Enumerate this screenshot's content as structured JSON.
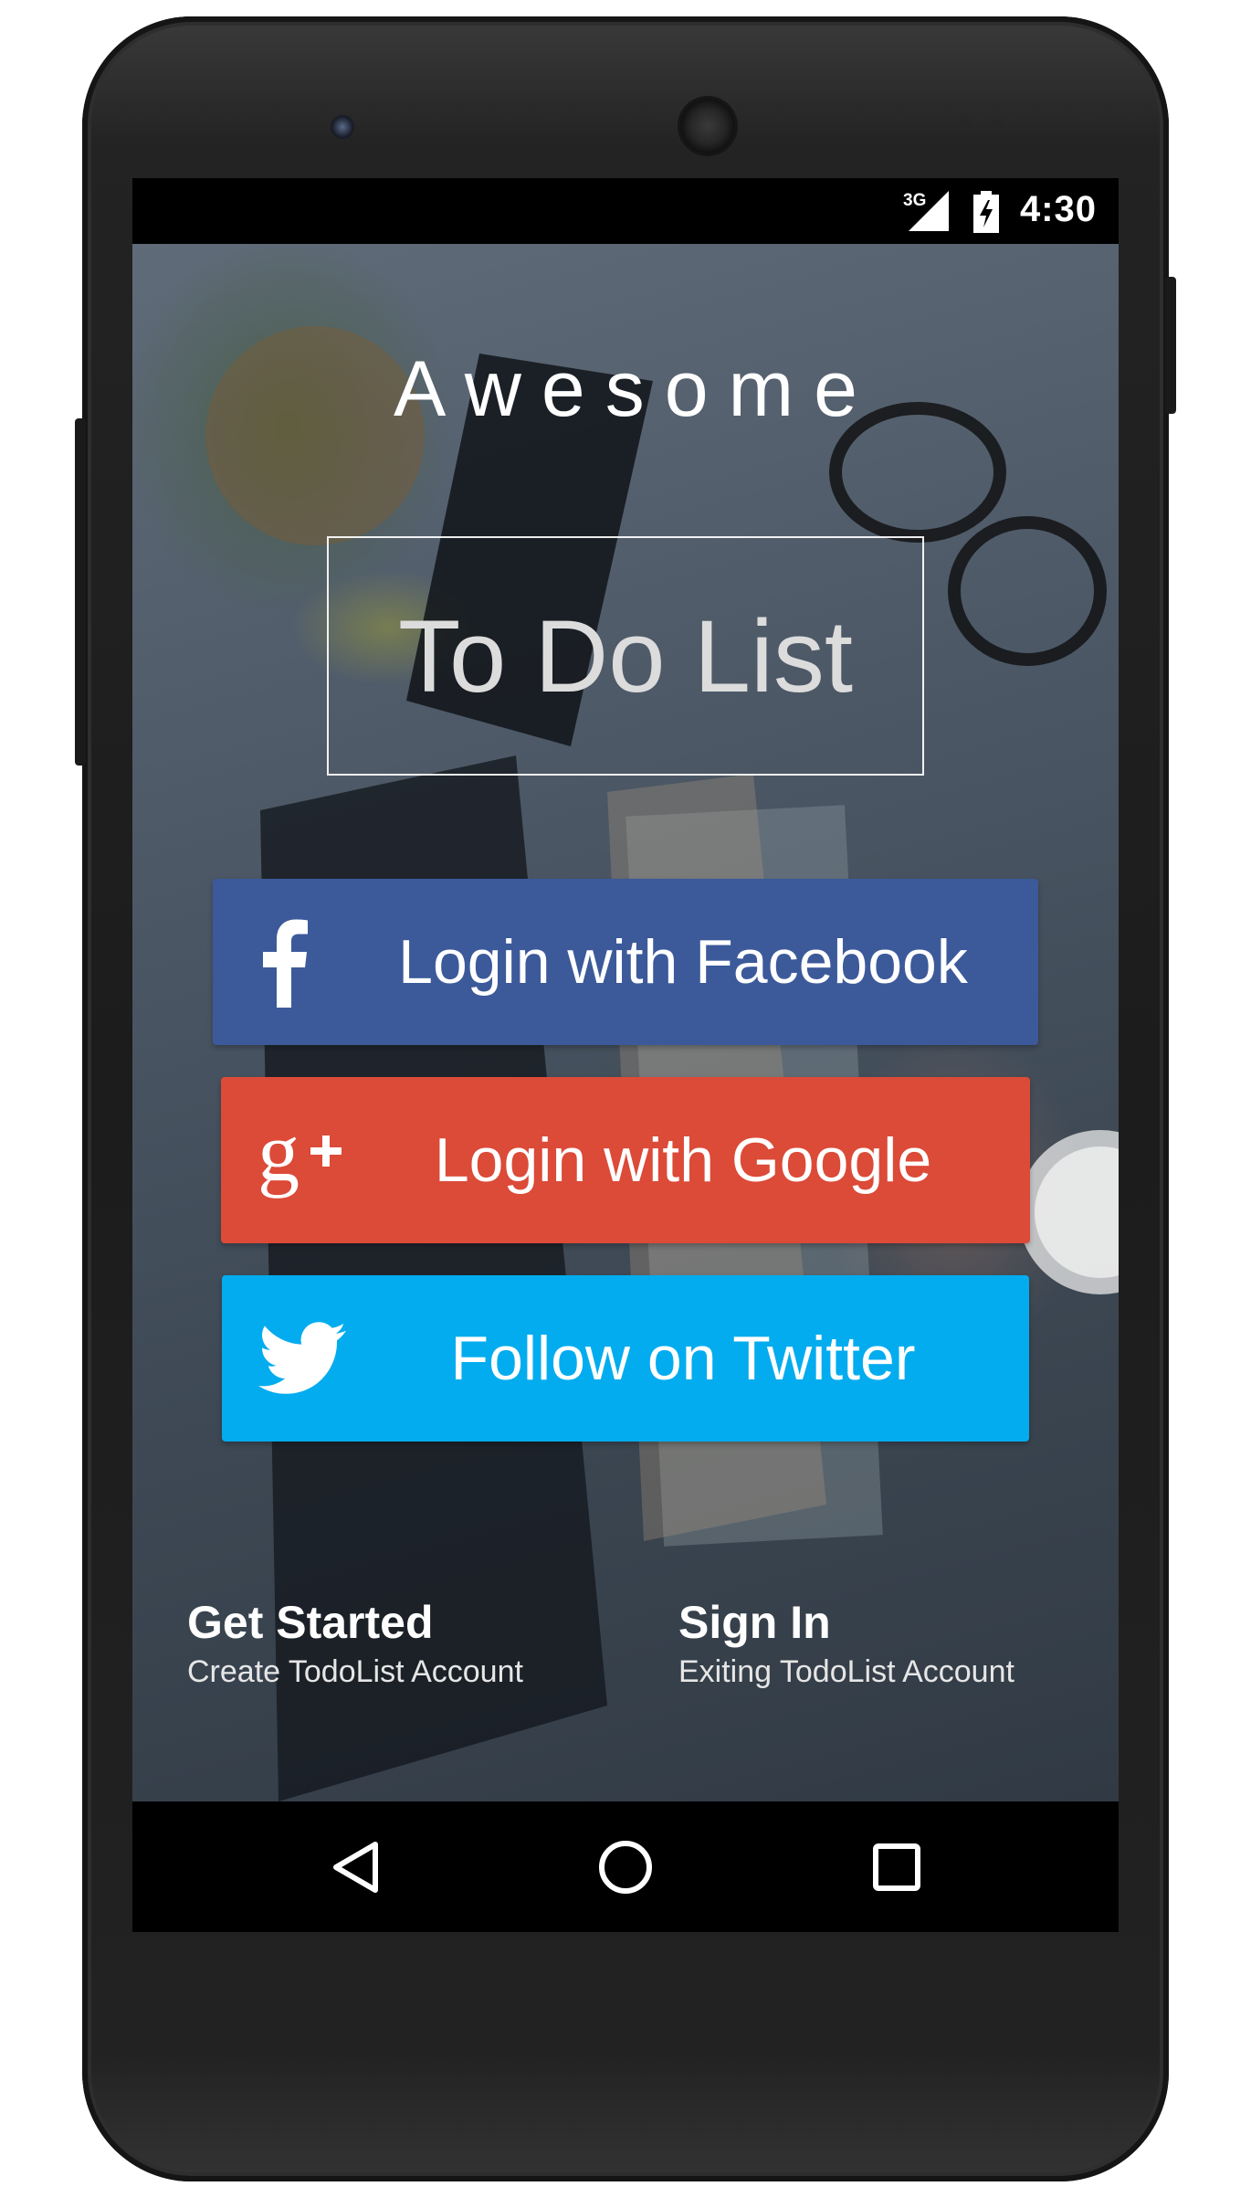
{
  "status_bar": {
    "network": "3G",
    "time": "4:30"
  },
  "app": {
    "title_top": "Awesome",
    "title_main": "To Do List"
  },
  "buttons": {
    "facebook": {
      "label": "Login with Facebook",
      "icon": "facebook-icon",
      "color": "#3c5a9a"
    },
    "google": {
      "label": "Login with Google",
      "icon": "google-plus-icon",
      "color": "#dc4a38"
    },
    "twitter": {
      "label": "Follow on Twitter",
      "icon": "twitter-bird-icon",
      "color": "#03acee"
    }
  },
  "actions": {
    "get_started": {
      "title": "Get Started",
      "subtitle": "Create TodoList Account"
    },
    "sign_in": {
      "title": "Sign In",
      "subtitle": "Exiting TodoList Account"
    }
  },
  "nav_bar": {
    "items": [
      {
        "icon": "back-triangle-icon"
      },
      {
        "icon": "home-circle-icon"
      },
      {
        "icon": "recents-square-icon"
      }
    ]
  }
}
